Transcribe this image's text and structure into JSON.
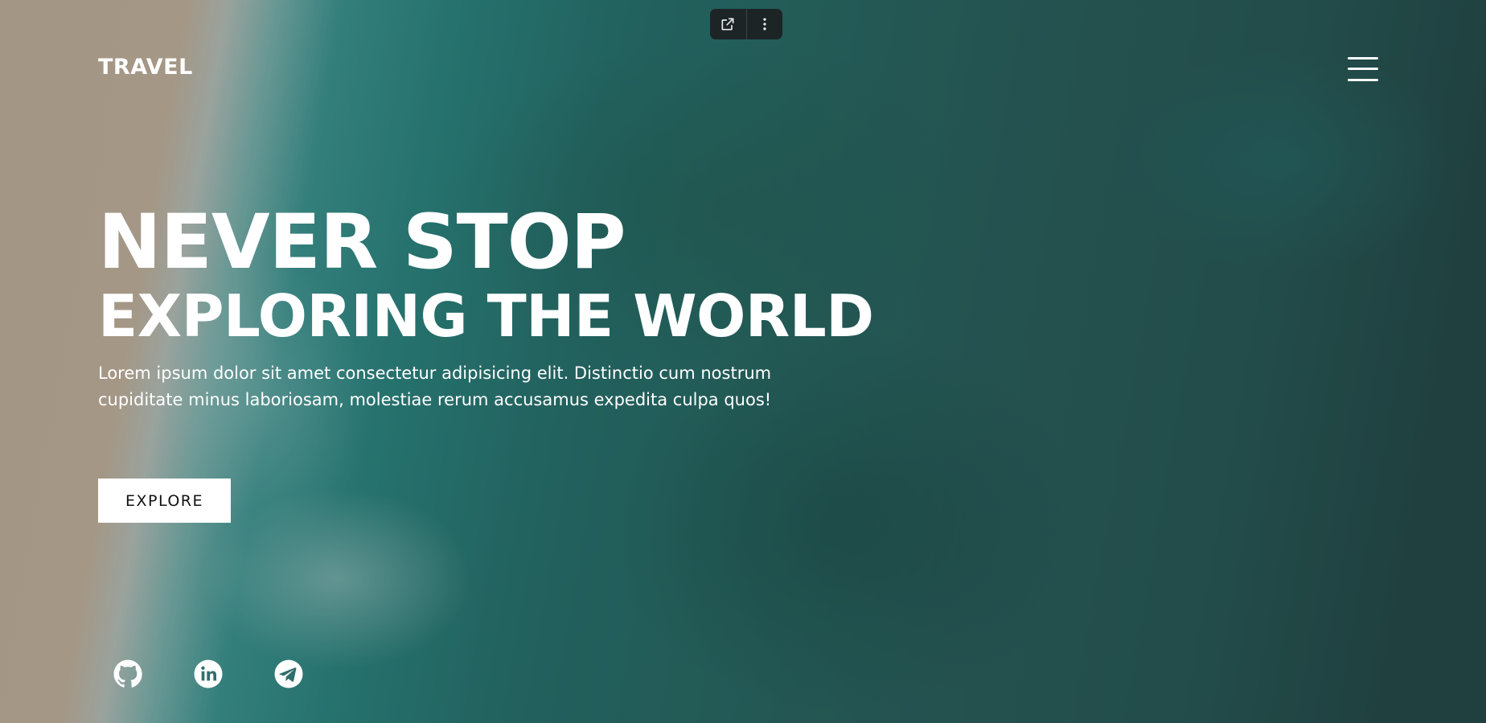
{
  "brand": {
    "logo_text": "TRAVEL"
  },
  "toolbar": {
    "open_icon": "external-link-icon",
    "more_icon": "more-vertical-icon"
  },
  "nav": {
    "menu_icon": "hamburger-menu-icon"
  },
  "hero": {
    "title_line1": "NEVER STOP",
    "title_line2": "EXPLORING THE WORLD",
    "description": "Lorem ipsum dolor sit amet consectetur adipisicing elit. Distinctio cum nostrum cupiditate minus laboriosam, molestiae rerum accusamus expedita culpa quos!",
    "cta_label": "EXPLORE"
  },
  "social": [
    {
      "name": "github",
      "icon": "github-icon"
    },
    {
      "name": "linkedin",
      "icon": "linkedin-icon"
    },
    {
      "name": "telegram",
      "icon": "telegram-icon"
    }
  ],
  "colors": {
    "text": "#ffffff",
    "button_bg": "#ffffff",
    "button_text": "#111111",
    "water": "#2c6461",
    "sand": "#c8b8a2"
  }
}
